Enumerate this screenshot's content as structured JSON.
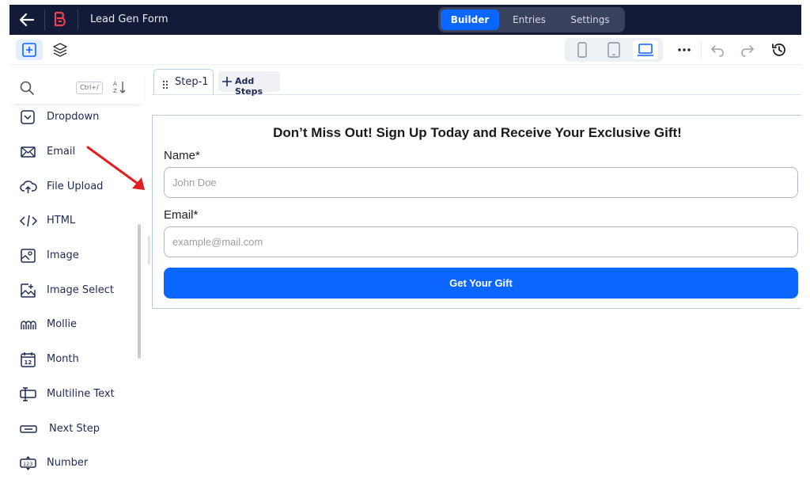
{
  "header": {
    "title": "Lead Gen Form",
    "mode_tabs": [
      {
        "label": "Builder",
        "active": true
      },
      {
        "label": "Entries",
        "active": false
      },
      {
        "label": "Settings",
        "active": false
      }
    ]
  },
  "toolbar": {
    "left_icons": [
      "add-field-icon",
      "layers-icon"
    ],
    "devices": [
      {
        "icon": "mobile-icon",
        "active": false
      },
      {
        "icon": "tablet-icon",
        "active": false
      },
      {
        "icon": "desktop-icon",
        "active": true
      }
    ],
    "right_icons": [
      "more-icon",
      "undo-icon",
      "redo-icon",
      "history-icon"
    ]
  },
  "sidebar": {
    "search_shortcut": "Ctrl+/",
    "fields": [
      {
        "label": "Dropdown",
        "icon": "dropdown-icon"
      },
      {
        "label": "Email",
        "icon": "email-icon"
      },
      {
        "label": "File Upload",
        "icon": "upload-icon"
      },
      {
        "label": "HTML",
        "icon": "code-icon"
      },
      {
        "label": "Image",
        "icon": "image-icon"
      },
      {
        "label": "Image Select",
        "icon": "image-select-icon"
      },
      {
        "label": "Mollie",
        "icon": "mollie-icon"
      },
      {
        "label": "Month",
        "icon": "calendar-icon"
      },
      {
        "label": "Multiline Text",
        "icon": "multiline-text-icon"
      },
      {
        "label": "Next Step",
        "icon": "next-step-icon"
      },
      {
        "label": "Number",
        "icon": "number-icon"
      }
    ]
  },
  "steps": {
    "tabs": [
      "Step-1"
    ],
    "add_label": "Add Steps"
  },
  "form": {
    "title": "Don’t Miss Out! Sign Up Today and Receive Your Exclusive Gift!",
    "fields": [
      {
        "label": "Name*",
        "placeholder": "John Doe",
        "value": ""
      },
      {
        "label": "Email*",
        "placeholder": "example@mail.com",
        "value": ""
      }
    ],
    "submit_label": "Get Your Gift"
  },
  "colors": {
    "header_bg": "#131b39",
    "accent": "#0a66ff",
    "annotation_arrow": "#e02020",
    "brand_logo": "#e8414f"
  }
}
